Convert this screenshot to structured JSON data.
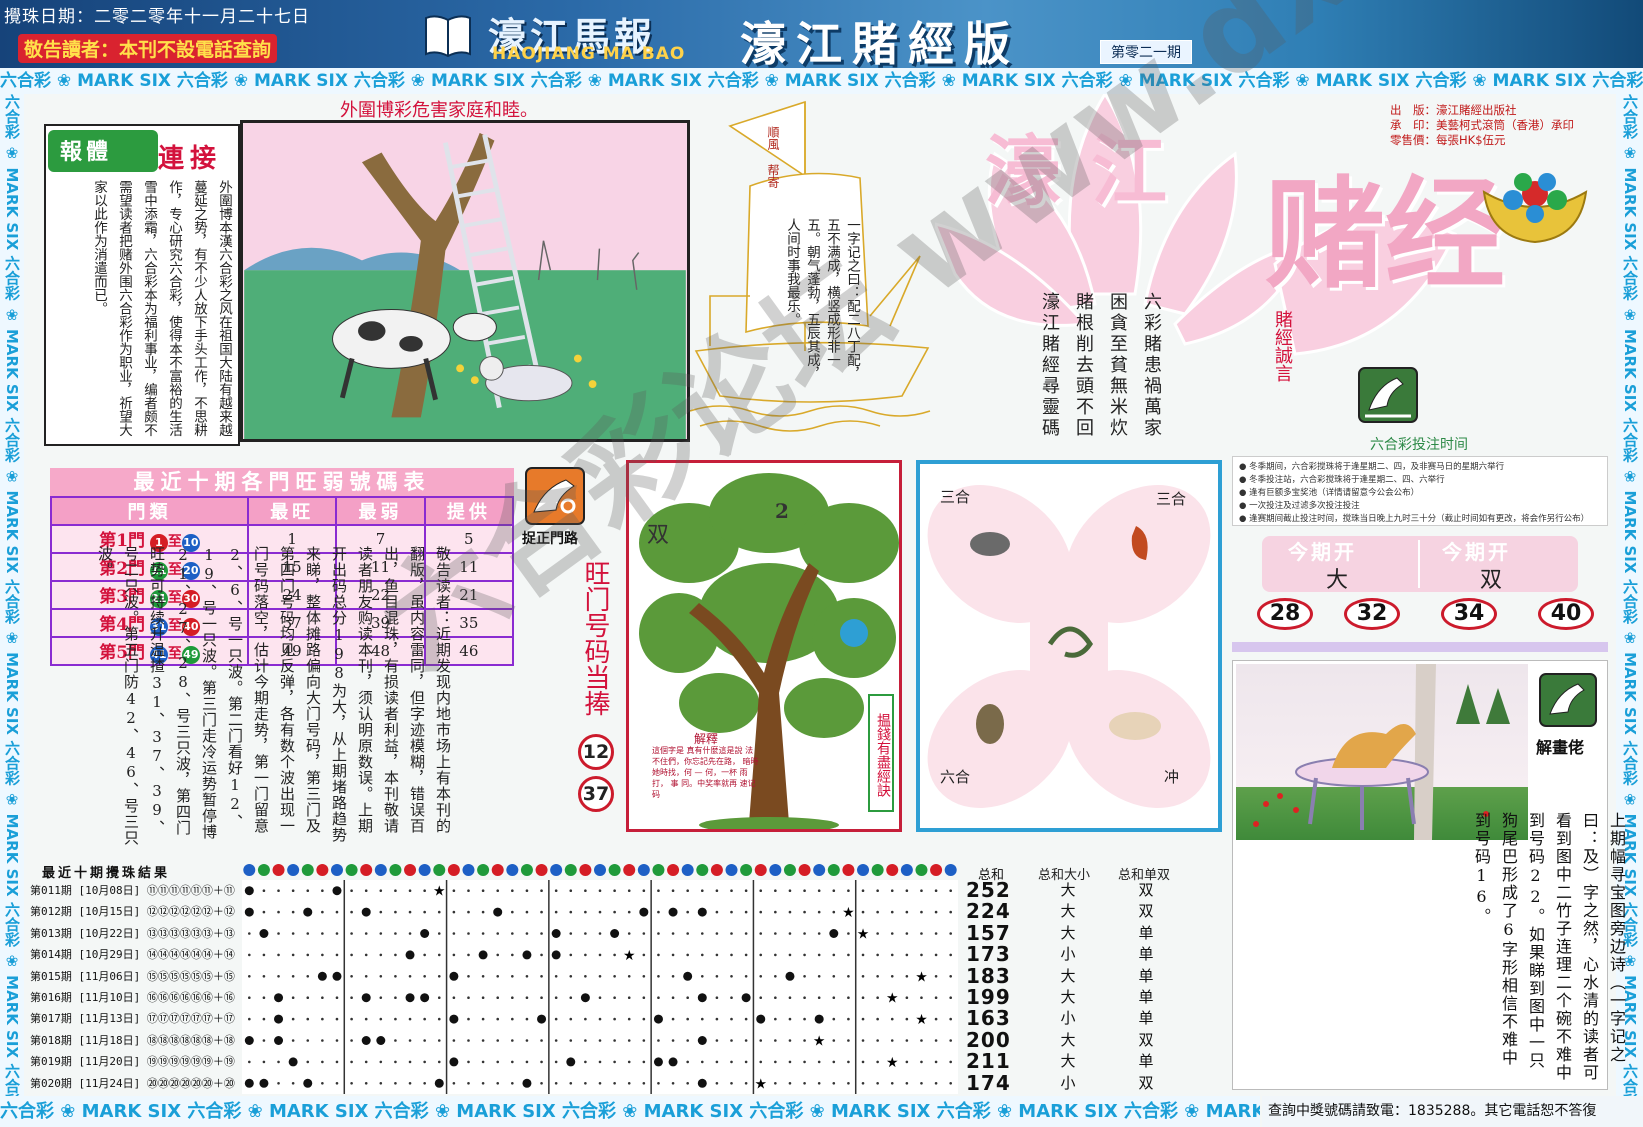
{
  "header": {
    "draw_date": "攪珠日期：二零二零年十一月二十七日",
    "notice": "敬告讀者：本刊不設電話查詢",
    "paper_title": "濠江馬報",
    "paper_roman": "HAOJIANG MA BAO",
    "edition_title": "濠江賭經版",
    "issue_no": "第零二一期"
  },
  "stripe_text": "六合彩 ❀ MARK SIX 六合彩 ❀ MARK SIX 六合彩 ❀ MARK SIX 六合彩 ❀ MARK SIX 六合彩 ❀ MARK SIX 六合彩 ❀ MARK SIX 六合彩 ❀ MARK SIX 六合彩 ❀ MARK SIX 六合彩 ❀ MARK SIX 六合彩 ❀ MARK SIX",
  "bottom_notice": "查詢中獎號碼請致電：1835288。其它電話恕不答復",
  "warning_heading": "外圍博彩危害家庭和睦。",
  "link_box": {
    "title_a": "報體",
    "title_b": "連接",
    "body": "外圍博本漢六合彩之风在祖国大陆有越来越蔓延之势，有不少人放下手头工作，不思耕作，专心研究六合彩，使得本不富裕的生活雪中添霜，六合彩本为福利事业，编者颇不需望读者把赌外围六合彩作为职业，祈望大家以此作为消遣而已。"
  },
  "boat": {
    "flag": "順風 帮寄",
    "verse": "一字记之曰：配二八丁配，五不满成，横竖成形非一五。朝气蓬勃，五辰其成，人间时事我最乐。"
  },
  "logo": {
    "line_a": "濠江",
    "line_b": "赌经"
  },
  "pub_info": [
    "出　版：濠江賭經出版社",
    "承　印：美藝柯式滾筒（香港）承印",
    "零售價：每張HK$伍元"
  ],
  "motto": {
    "label": "賭經誠言",
    "lines": [
      "六彩賭患禍萬家",
      "困貪至貧無米炊",
      "賭根削去頭不回",
      "濠江賭經尋靈碼"
    ]
  },
  "betting_times": {
    "title": "六合彩投注时间",
    "lines": [
      "● 冬季期间，六合彩搅珠将于逢星期二、四，及非赛马日的星期六举行",
      "● 冬季投注站，六合彩搅珠将于逢星期二、四、六举行",
      "● 逢有巨额多宝奖池（详情请留意今公会公布）",
      "● 一次投注及过滤多次投注投注",
      "● 逢赛期间截止投注时间，搅珠当日晚上九时三十分（截止时间如有更改，将会作另行公布）"
    ]
  },
  "draw_result": {
    "label_left": "今期开",
    "value_left": "大",
    "label_right": "今期开",
    "value_right": "双",
    "numbers": [
      "28",
      "32",
      "34",
      "40"
    ]
  },
  "gate_table": {
    "title": "最近十期各門旺弱號碼表",
    "headers": [
      "門類",
      "最旺",
      "最弱",
      "提供"
    ],
    "rows": [
      {
        "gate": "第1門",
        "from": "1",
        "to": "10",
        "hot": "1",
        "weak": "7",
        "offer": "5",
        "c1": "#d51d25",
        "c2": "#1d5fc5"
      },
      {
        "gate": "第2門",
        "from": "11",
        "to": "20",
        "hot": "15",
        "weak": "11",
        "offer": "11",
        "c1": "#1f9a3a",
        "c2": "#1d5fc5"
      },
      {
        "gate": "第3門",
        "from": "21",
        "to": "30",
        "hot": "24",
        "weak": "22",
        "offer": "21",
        "c1": "#1f9a3a",
        "c2": "#d51d25"
      },
      {
        "gate": "第4門",
        "from": "31",
        "to": "40",
        "hot": "37",
        "weak": "39",
        "offer": "35",
        "c1": "#1d5fc5",
        "c2": "#d51d25"
      },
      {
        "gate": "第5門",
        "from": "41",
        "to": "49",
        "hot": "49",
        "weak": "48",
        "offer": "46",
        "c1": "#1d5fc5",
        "c2": "#1f9a3a"
      }
    ],
    "between": "至"
  },
  "correct_gate_label": "捉正門路",
  "hot_numbers": {
    "title": "旺门号码当捧",
    "numbers": [
      "12",
      "37"
    ]
  },
  "article": [
    "敬告读者：近期发现内地市场上有本刊的翻版，虽内容雷同，但字迹模糊，错误百出，鱼目混珠，有损读者利益，本刊敬请读者朋友购读本刊，须认明原数误。上期开出码总分198为大，从上期堵路趋势来睇，整体摊路偏向大门号码，第三门及第四门号码均见反弹，各有数个波出现一门号码落空，估计今期走势，第一门留意2、6、号一只波。第二门看好12、19、号一只波。第三门走冷运势暂停博21、27、28、号三只波，第四门旺势可持续升温揸31、37、39、号二只波。第五门防42、46、号三只波。"
  ],
  "tree": {
    "label_left": "双",
    "label_right": "2",
    "side": "揾錢有盡經訣",
    "inset_title": "解釋",
    "inset_body": "這個字是 真有什麼這是說 法不住們，你忘記先在路， 暗時 她時找，何 — 何，一杯 雨打， 事 同。中奖率就再 速记码"
  },
  "zodiac": {
    "top_left": "三合",
    "top_right": "三合",
    "bottom_left": "六合",
    "bottom_right": "冲"
  },
  "guess": {
    "label": "解畫佬",
    "riddle": "上期幅寻宝图旁边诗（一字记之曰：及）字之然，心水清的读者可看到图中二竹子连理二个碗不难中到号码22。如果睇到图中一只狗尾巴形成了6字形相信不难中到号码16。"
  },
  "results": {
    "title": "最近十期攪珠結果",
    "ball_count": 49,
    "sum_header": "总和",
    "size_header": "总和大小",
    "odd_header": "总和单双",
    "rows": [
      {
        "label": "第011期 [10月08日] ⑪⑪⑪⑪⑪⑪＋⑪",
        "sum": "252",
        "size": "大",
        "parity": "双",
        "marks": [
          1,
          7,
          14
        ]
      },
      {
        "label": "第012期 [10月15日] ⑫⑫⑫⑫⑫⑫＋⑫",
        "sum": "224",
        "size": "大",
        "parity": "双",
        "marks": [
          1,
          5,
          9,
          18,
          28,
          30,
          32,
          42
        ]
      },
      {
        "label": "第013期 [10月22日] ⑬⑬⑬⑬⑬⑬＋⑬",
        "sum": "157",
        "size": "大",
        "parity": "单",
        "marks": [
          2,
          13,
          22,
          26,
          41,
          43
        ]
      },
      {
        "label": "第014期 [10月29日] ⑭⑭⑭⑭⑭⑭＋⑭",
        "sum": "173",
        "size": "小",
        "parity": "单",
        "marks": [
          12,
          17,
          20,
          22,
          27
        ]
      },
      {
        "label": "第015期 [11月06日] ⑮⑮⑮⑮⑮⑮＋⑮",
        "sum": "183",
        "size": "大",
        "parity": "单",
        "marks": [
          6,
          7,
          15,
          31,
          38,
          47
        ]
      },
      {
        "label": "第016期 [11月10日] ⑯⑯⑯⑯⑯⑯＋⑯",
        "sum": "199",
        "size": "大",
        "parity": "单",
        "marks": [
          3,
          9,
          12,
          13,
          24,
          32,
          35,
          45
        ]
      },
      {
        "label": "第017期 [11月13日] ⑰⑰⑰⑰⑰⑰＋⑰",
        "sum": "163",
        "size": "小",
        "parity": "单",
        "marks": [
          3,
          15,
          21,
          29,
          36,
          40,
          47
        ]
      },
      {
        "label": "第018期 [11月18日] ⑱⑱⑱⑱⑱⑱＋⑱",
        "sum": "200",
        "size": "大",
        "parity": "双",
        "marks": [
          1,
          3,
          9,
          10,
          32,
          40
        ]
      },
      {
        "label": "第019期 [11月20日] ⑲⑲⑲⑲⑲⑲＋⑲",
        "sum": "211",
        "size": "大",
        "parity": "单",
        "marks": [
          4,
          15,
          23,
          29,
          30,
          45
        ]
      },
      {
        "label": "第020期 [11月24日] ⑳⑳⑳⑳⑳⑳＋⑳",
        "sum": "174",
        "size": "小",
        "parity": "双",
        "marks": [
          1,
          2,
          5,
          14,
          20,
          32,
          36
        ]
      }
    ]
  },
  "watermark": "六合彩论坛 www.dxbbolt.com",
  "colors": {
    "red": "#d3123c",
    "green": "#2c9b3f",
    "blue": "#2e9fd4",
    "pink": "#f6a9c9",
    "purple": "#8a2bd1"
  }
}
